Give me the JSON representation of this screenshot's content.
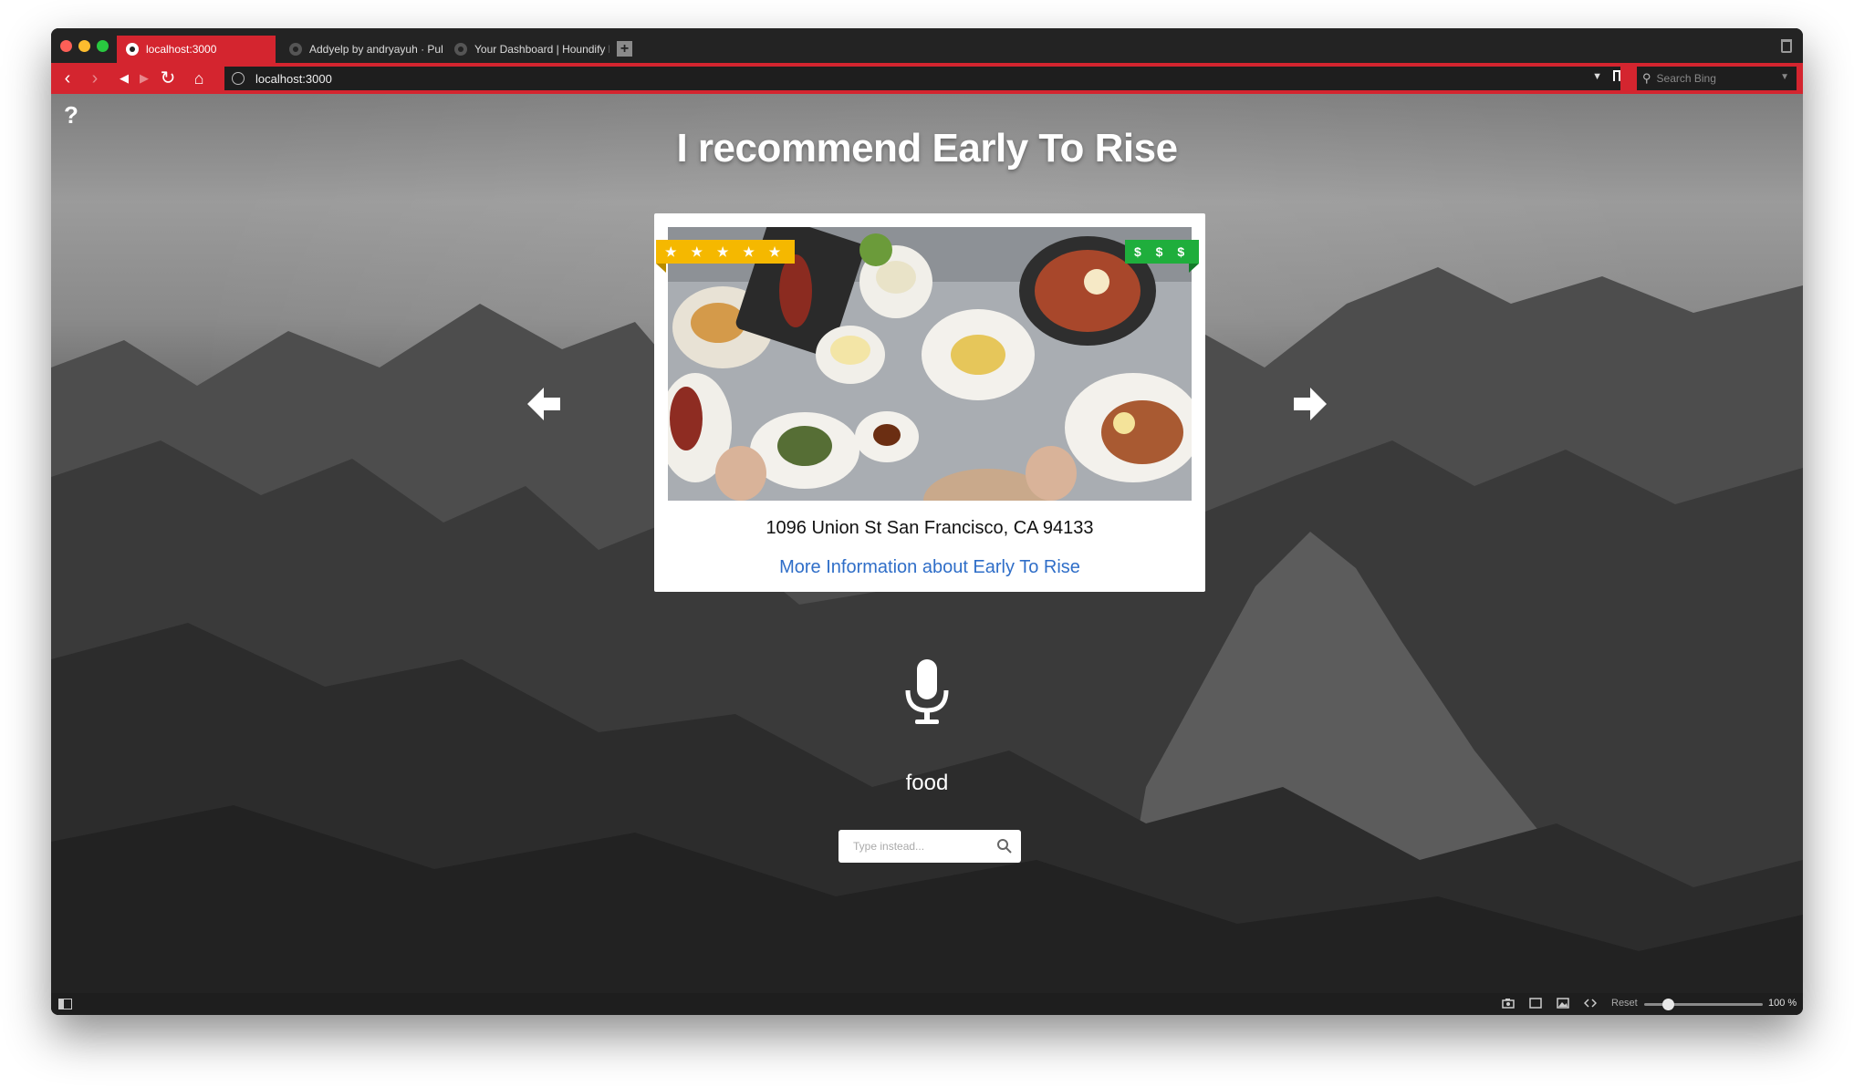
{
  "browser": {
    "tabs": [
      {
        "label": "localhost:3000",
        "active": true
      },
      {
        "label": "Addyelp by andryayuh · Pull R",
        "active": false
      },
      {
        "label": "Your Dashboard | Houndify D",
        "active": false
      }
    ],
    "url": "localhost:3000",
    "search_placeholder": "Search Bing",
    "accent_color": "#d4252f"
  },
  "page": {
    "help_label": "?",
    "headline": "I recommend Early To Rise",
    "card": {
      "rating_label": "★ ★ ★ ★ ★",
      "rating": 5,
      "price_label": "$ $ $",
      "address": "1096 Union St San Francisco, CA 94133",
      "more_info_link": "More Information about Early To Rise"
    },
    "voice_query": "food",
    "type_placeholder": "Type instead..."
  },
  "statusbar": {
    "reset_label": "Reset",
    "zoom": "100 %"
  }
}
